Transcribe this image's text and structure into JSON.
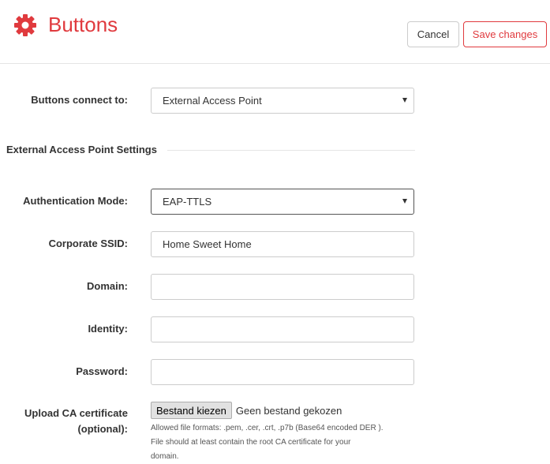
{
  "header": {
    "title": "Buttons",
    "icon": "gear-icon",
    "accent_color": "#e03a3e",
    "cancel_label": "Cancel",
    "save_label": "Save changes"
  },
  "form": {
    "buttons_connect_to": {
      "label": "Buttons connect to:",
      "value": "External Access Point"
    },
    "section_title": "External Access Point Settings",
    "authentication_mode": {
      "label": "Authentication Mode:",
      "value": "EAP-TTLS"
    },
    "corporate_ssid": {
      "label": "Corporate SSID:",
      "value": "Home Sweet Home"
    },
    "domain": {
      "label": "Domain:",
      "value": ""
    },
    "identity": {
      "label": "Identity:",
      "value": ""
    },
    "password": {
      "label": "Password:",
      "value": ""
    },
    "upload_ca": {
      "label_line1": "Upload CA certificate",
      "label_line2": "(optional):",
      "button_label": "Bestand kiezen",
      "status": "Geen bestand gekozen",
      "help_line1": "Allowed file formats: .pem, .cer, .crt, .p7b (Base64 encoded DER ).",
      "help_line2": "File should at least contain the root CA certificate for your",
      "help_line3": "domain."
    }
  }
}
